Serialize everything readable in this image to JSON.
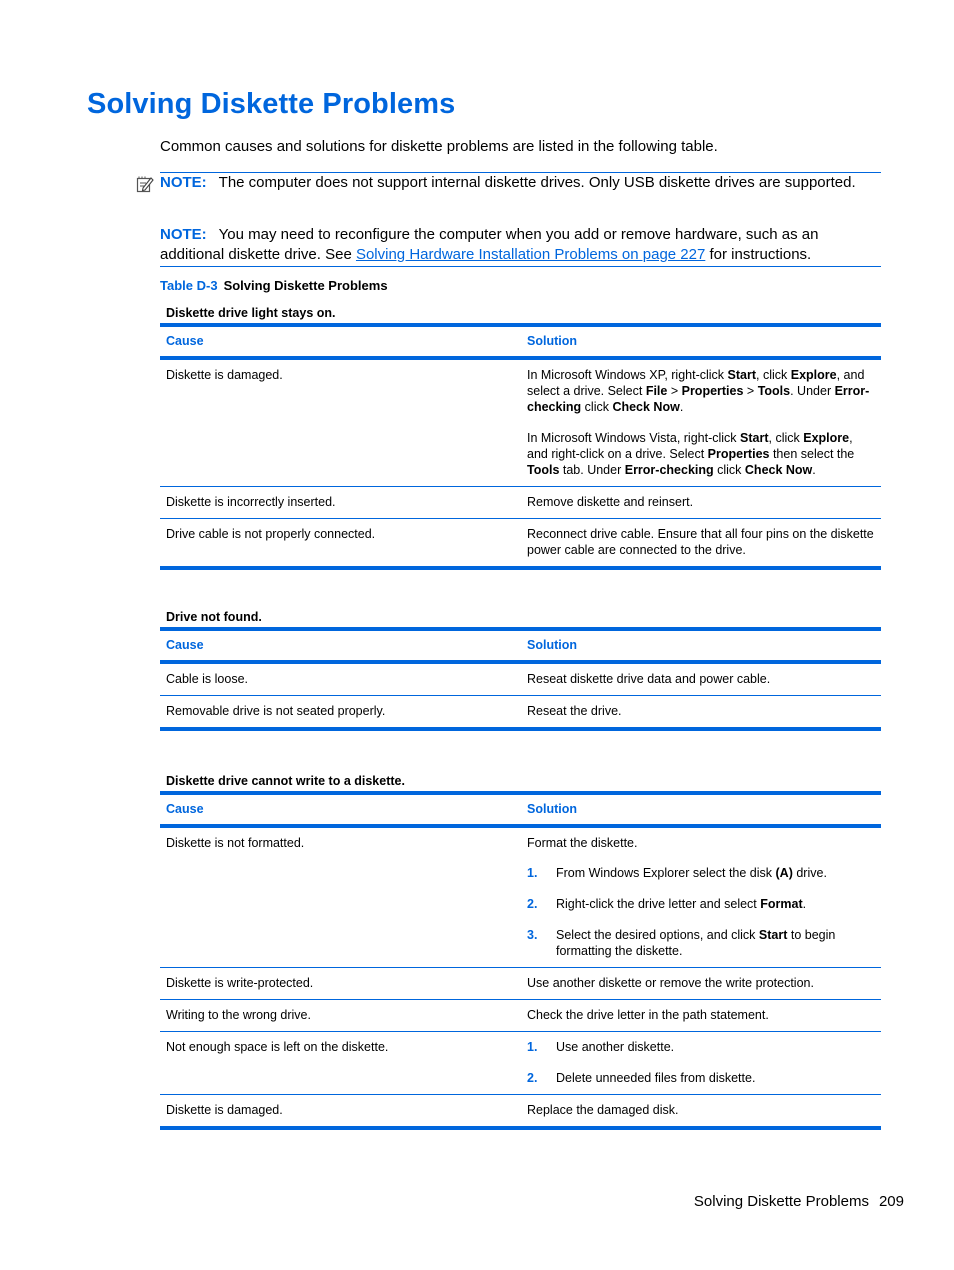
{
  "title": "Solving Diskette Problems",
  "intro": "Common causes and solutions for diskette problems are listed in the following table.",
  "notes": [
    {
      "label": "NOTE:",
      "text": "The computer does not support internal diskette drives. Only USB diskette drives are supported.",
      "icon": "note-pencil-icon"
    },
    {
      "label": "NOTE:",
      "text_before": "You may need to reconfigure the computer when you add or remove hardware, such as an additional diskette drive. See ",
      "link": "Solving Hardware Installation Problems on page 227",
      "text_after": " for instructions."
    }
  ],
  "table_caption": {
    "number": "Table D-3",
    "title": "Solving Diskette Problems"
  },
  "headers": {
    "cause": "Cause",
    "solution": "Solution"
  },
  "sections": [
    {
      "subtitle": "Diskette drive light stays on.",
      "rows": [
        {
          "cause": "Diskette is damaged.",
          "solution_paragraphs": [
            [
              {
                "t": "In Microsoft Windows XP, right-click "
              },
              {
                "b": "Start"
              },
              {
                "t": ", click "
              },
              {
                "b": "Explore"
              },
              {
                "t": ", and select a drive. Select "
              },
              {
                "b": "File"
              },
              {
                "t": " > "
              },
              {
                "b": "Properties"
              },
              {
                "t": " > "
              },
              {
                "b": "Tools"
              },
              {
                "t": ". Under "
              },
              {
                "b": "Error-checking"
              },
              {
                "t": " click "
              },
              {
                "b": "Check Now"
              },
              {
                "t": "."
              }
            ],
            [
              {
                "t": "In Microsoft Windows Vista, right-click "
              },
              {
                "b": "Start"
              },
              {
                "t": ", click "
              },
              {
                "b": "Explore"
              },
              {
                "t": ", and right-click on a drive. Select "
              },
              {
                "b": "Properties"
              },
              {
                "t": " then select the "
              },
              {
                "b": "Tools"
              },
              {
                "t": " tab. Under "
              },
              {
                "b": "Error-checking"
              },
              {
                "t": " click "
              },
              {
                "b": "Check Now"
              },
              {
                "t": "."
              }
            ]
          ]
        },
        {
          "cause": "Diskette is incorrectly inserted.",
          "solution_paragraphs": [
            [
              {
                "t": "Remove diskette and reinsert."
              }
            ]
          ]
        },
        {
          "cause": "Drive cable is not properly connected.",
          "solution_paragraphs": [
            [
              {
                "t": "Reconnect drive cable. Ensure that all four pins on the diskette power cable are connected to the drive."
              }
            ]
          ]
        }
      ]
    },
    {
      "subtitle": "Drive not found.",
      "rows": [
        {
          "cause": "Cable is loose.",
          "solution_paragraphs": [
            [
              {
                "t": "Reseat diskette drive data and power cable."
              }
            ]
          ]
        },
        {
          "cause": "Removable drive is not seated properly.",
          "solution_paragraphs": [
            [
              {
                "t": "Reseat the drive."
              }
            ]
          ]
        }
      ]
    },
    {
      "subtitle": "Diskette drive cannot write to a diskette.",
      "rows": [
        {
          "cause": "Diskette is not formatted.",
          "solution_paragraphs": [
            [
              {
                "t": "Format the diskette."
              }
            ]
          ],
          "steps": [
            {
              "num": "1.",
              "parts": [
                {
                  "t": "From Windows Explorer select the disk "
                },
                {
                  "b": "(A)"
                },
                {
                  "t": " drive."
                }
              ]
            },
            {
              "num": "2.",
              "parts": [
                {
                  "t": "Right-click the drive letter and select "
                },
                {
                  "b": "Format"
                },
                {
                  "t": "."
                }
              ]
            },
            {
              "num": "3.",
              "parts": [
                {
                  "t": "Select the desired options, and click "
                },
                {
                  "b": "Start"
                },
                {
                  "t": " to begin formatting the diskette."
                }
              ]
            }
          ]
        },
        {
          "cause": "Diskette is write-protected.",
          "solution_paragraphs": [
            [
              {
                "t": "Use another diskette or remove the write protection."
              }
            ]
          ]
        },
        {
          "cause": "Writing to the wrong drive.",
          "solution_paragraphs": [
            [
              {
                "t": "Check the drive letter in the path statement."
              }
            ]
          ]
        },
        {
          "cause": "Not enough space is left on the diskette.",
          "steps_only": true,
          "steps": [
            {
              "num": "1.",
              "parts": [
                {
                  "t": "Use another diskette."
                }
              ]
            },
            {
              "num": "2.",
              "parts": [
                {
                  "t": "Delete unneeded files from diskette."
                }
              ]
            }
          ]
        },
        {
          "cause": "Diskette is damaged.",
          "solution_paragraphs": [
            [
              {
                "t": "Replace the damaged disk."
              }
            ]
          ]
        }
      ]
    }
  ],
  "footer": {
    "section": "Solving Diskette Problems",
    "page": "209"
  },
  "colors": {
    "accent": "#0066dd",
    "text": "#000000"
  }
}
